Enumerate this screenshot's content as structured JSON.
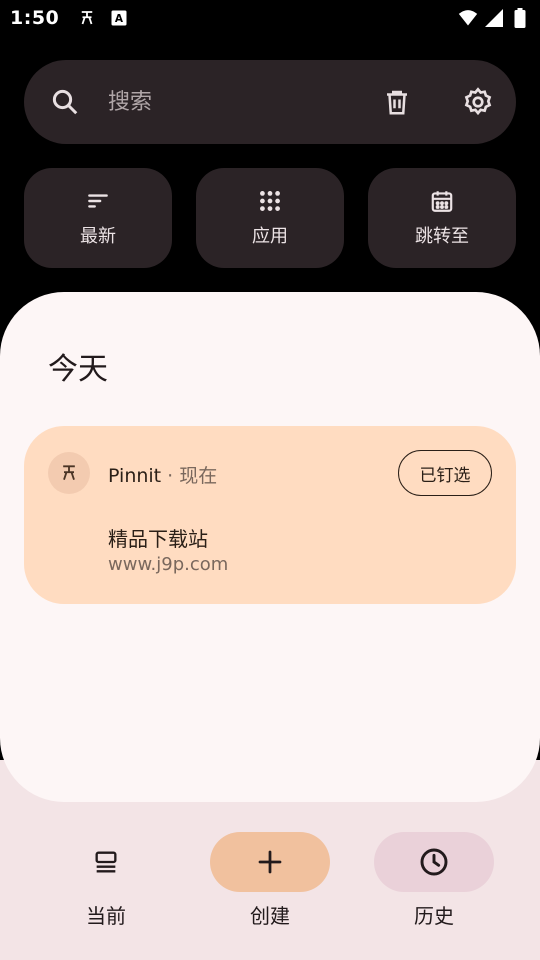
{
  "status_bar": {
    "time": "1:50",
    "left_icons": [
      "pin-notification-icon",
      "font-a-icon"
    ],
    "right_icons": [
      "wifi-icon",
      "signal-icon",
      "battery-icon"
    ]
  },
  "search": {
    "placeholder": "搜索",
    "trash_icon": "trash-icon",
    "settings_icon": "gear-icon"
  },
  "quick_actions": [
    {
      "label": "最新",
      "icon": "sort-icon"
    },
    {
      "label": "应用",
      "icon": "apps-grid-icon"
    },
    {
      "label": "跳转至",
      "icon": "calendar-icon"
    }
  ],
  "main": {
    "section_title": "今天",
    "card": {
      "app_name": "Pinnit",
      "separator": "·",
      "time": "现在",
      "pinned_label": "已钉选",
      "title": "精品下载站",
      "subtitle": "www.j9p.com"
    }
  },
  "bottom_nav": {
    "items": [
      {
        "label": "当前",
        "icon": "current-stack-icon"
      },
      {
        "label": "创建",
        "icon": "plus-icon"
      },
      {
        "label": "历史",
        "icon": "clock-icon"
      }
    ]
  },
  "colors": {
    "background": "#000000",
    "surface_dark": "#2b2326",
    "sheet": "#fdf6f6",
    "card": "#ffdcc1",
    "create_pill": "#f1c19e",
    "history_pill": "#ead1d9",
    "bottom_area": "#f3e4e6"
  }
}
